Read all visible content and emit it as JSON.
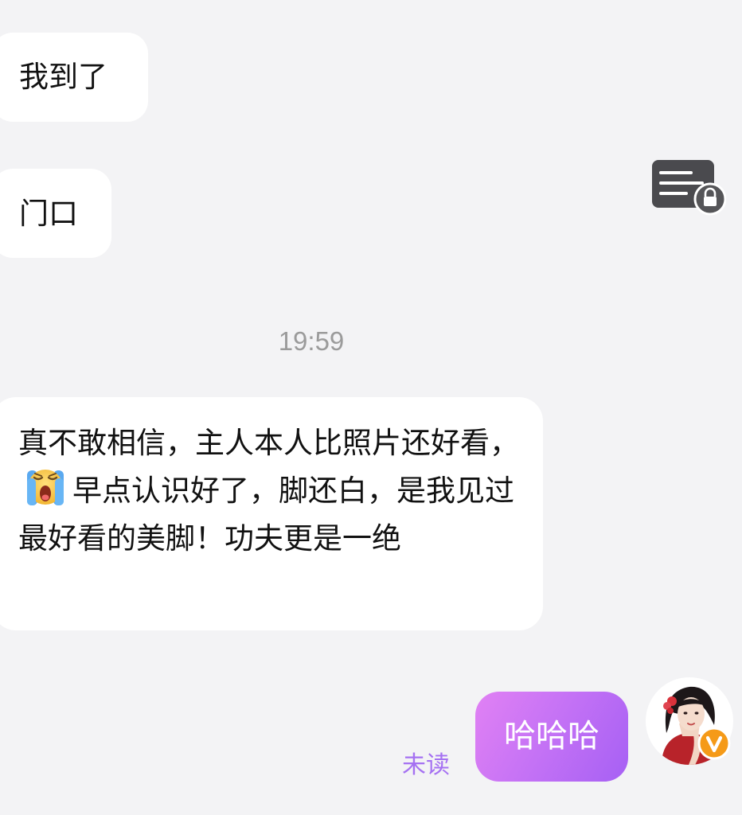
{
  "conversation": {
    "messages": [
      {
        "direction": "incoming",
        "text": "我到了"
      },
      {
        "direction": "incoming",
        "text": "门口"
      }
    ],
    "timestamp": "19:59",
    "long_message": {
      "direction": "incoming",
      "text_before_emoji": "真不敢相信，主人本人比照片还好看，",
      "emoji": "loudly-crying-face",
      "text_after_emoji": "早点认识好了，脚还白，是我见过最好看的美脚！功夫更是一绝"
    },
    "outgoing_message": {
      "text": "哈哈哈",
      "status": "未读"
    }
  },
  "icons": {
    "encrypted": "encrypted-message-lock-icon",
    "verified": "verified-v-badge-icon",
    "avatar": "user-avatar"
  },
  "colors": {
    "background": "#f3f3f5",
    "bubble_incoming": "#ffffff",
    "bubble_outgoing_start": "#e181f4",
    "bubble_outgoing_end": "#a660f4",
    "unread_text": "#a571f2",
    "timestamp_text": "#9b9b9b",
    "badge": "#f59a18"
  }
}
